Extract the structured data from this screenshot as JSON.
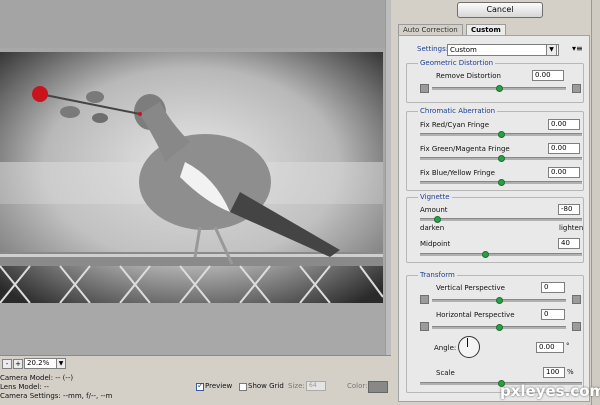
{
  "toolbar": {
    "cancel_label": "Cancel"
  },
  "tabs": [
    {
      "label": "Auto Correction"
    },
    {
      "label": "Custom"
    }
  ],
  "settings": {
    "label": "Settings:",
    "value": "Custom"
  },
  "geometric": {
    "title": "Geometric Distortion",
    "remove_label": "Remove Distortion",
    "remove_value": "0.00",
    "remove_level": 0.5
  },
  "chromatic": {
    "title": "Chromatic Aberration",
    "red_label": "Fix Red/Cyan Fringe",
    "red_value": "0.00",
    "green_label": "Fix Green/Magenta Fringe",
    "green_value": "0.00",
    "blue_label": "Fix Blue/Yellow Fringe",
    "blue_value": "0.00"
  },
  "vignette": {
    "title": "Vignette",
    "amount_label": "Amount",
    "amount_value": "-80",
    "darken_label": "darken",
    "lighten_label": "lighten",
    "midpoint_label": "Midpoint",
    "midpoint_value": "40"
  },
  "transform": {
    "title": "Transform",
    "vertical_label": "Vertical Perspective",
    "vertical_value": "0",
    "horizontal_label": "Horizontal Perspective",
    "horizontal_value": "0",
    "angle_label": "Angle:",
    "angle_value": "0.00",
    "angle_unit": "°",
    "scale_label": "Scale",
    "scale_value": "100",
    "scale_unit": "%"
  },
  "zoom": {
    "minus": "-",
    "plus": "+",
    "value": "20.2%"
  },
  "status": {
    "camera_model": "Camera Model: -- (--)",
    "lens_model": "Lens Model: --",
    "camera_settings": "Camera Settings: --mm, f/--, --m"
  },
  "options": {
    "preview_label": "Preview",
    "show_grid_label": "Show Grid",
    "size_label": "Size:",
    "size_value": "64",
    "color_label": "Color:"
  },
  "colors": {
    "accent": "#1d3f94",
    "slider_thumb": "#28a046",
    "rose": "#c8141e"
  },
  "watermark": "pxleyes.com"
}
